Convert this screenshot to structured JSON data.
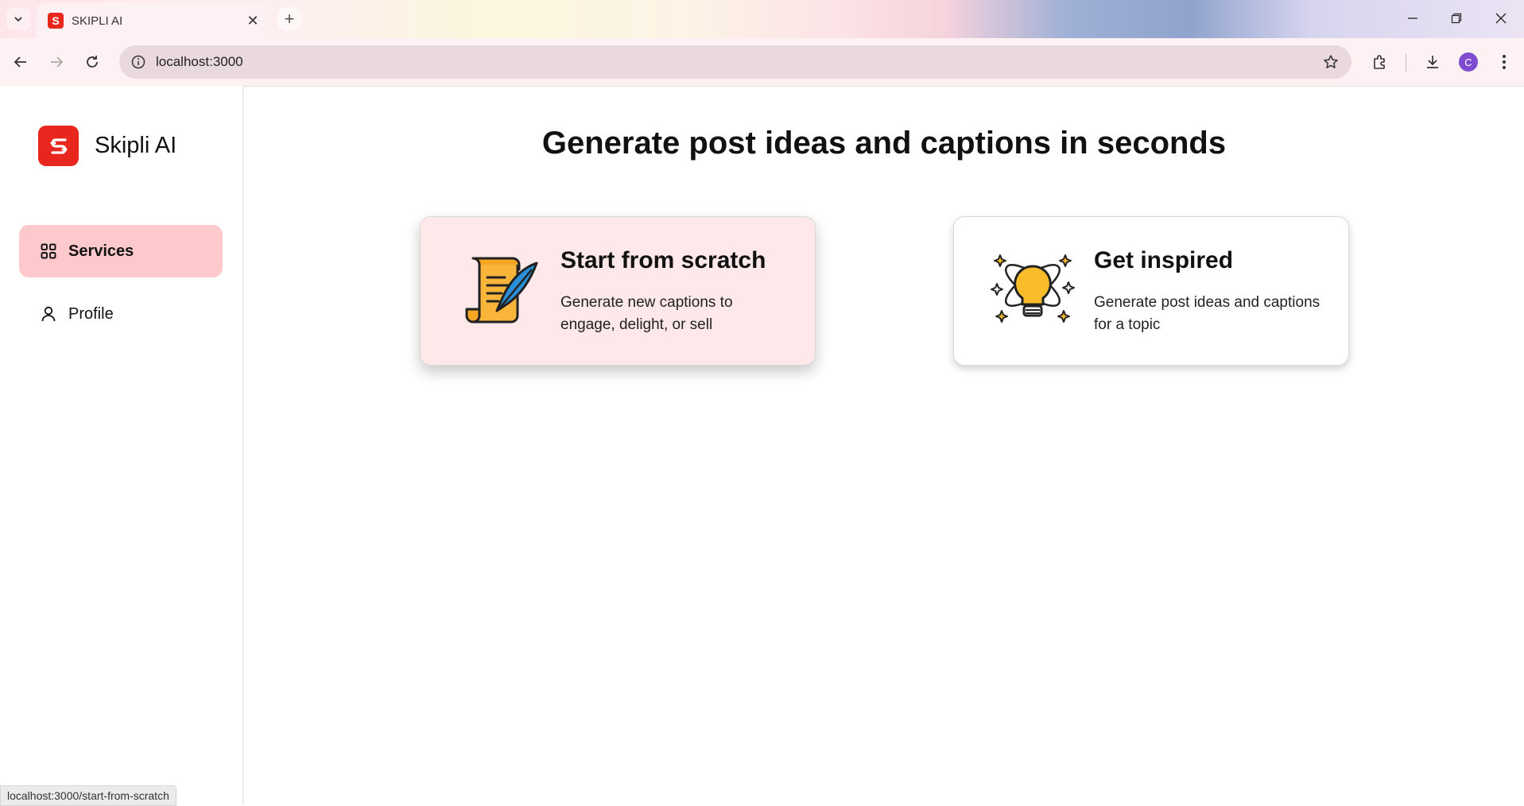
{
  "browser": {
    "tab_title": "SKIPLI AI",
    "url": "localhost:3000",
    "profile_initial": "C",
    "status_url": "localhost:3000/start-from-scratch"
  },
  "sidebar": {
    "brand": "Skipli AI",
    "items": [
      {
        "label": "Services",
        "icon": "grid-icon",
        "active": true
      },
      {
        "label": "Profile",
        "icon": "user-icon",
        "active": false
      }
    ]
  },
  "main": {
    "headline": "Generate post ideas and captions in seconds",
    "cards": [
      {
        "title": "Start from scratch",
        "description": "Generate new captions to engage, delight, or sell",
        "icon": "scroll-quill-icon"
      },
      {
        "title": "Get inspired",
        "description": "Generate post ideas and captions for a topic",
        "icon": "lightbulb-icon"
      }
    ]
  },
  "colors": {
    "brand": "#e8261d",
    "active_nav": "#fec9cc",
    "card_hover": "#fee8e9"
  }
}
